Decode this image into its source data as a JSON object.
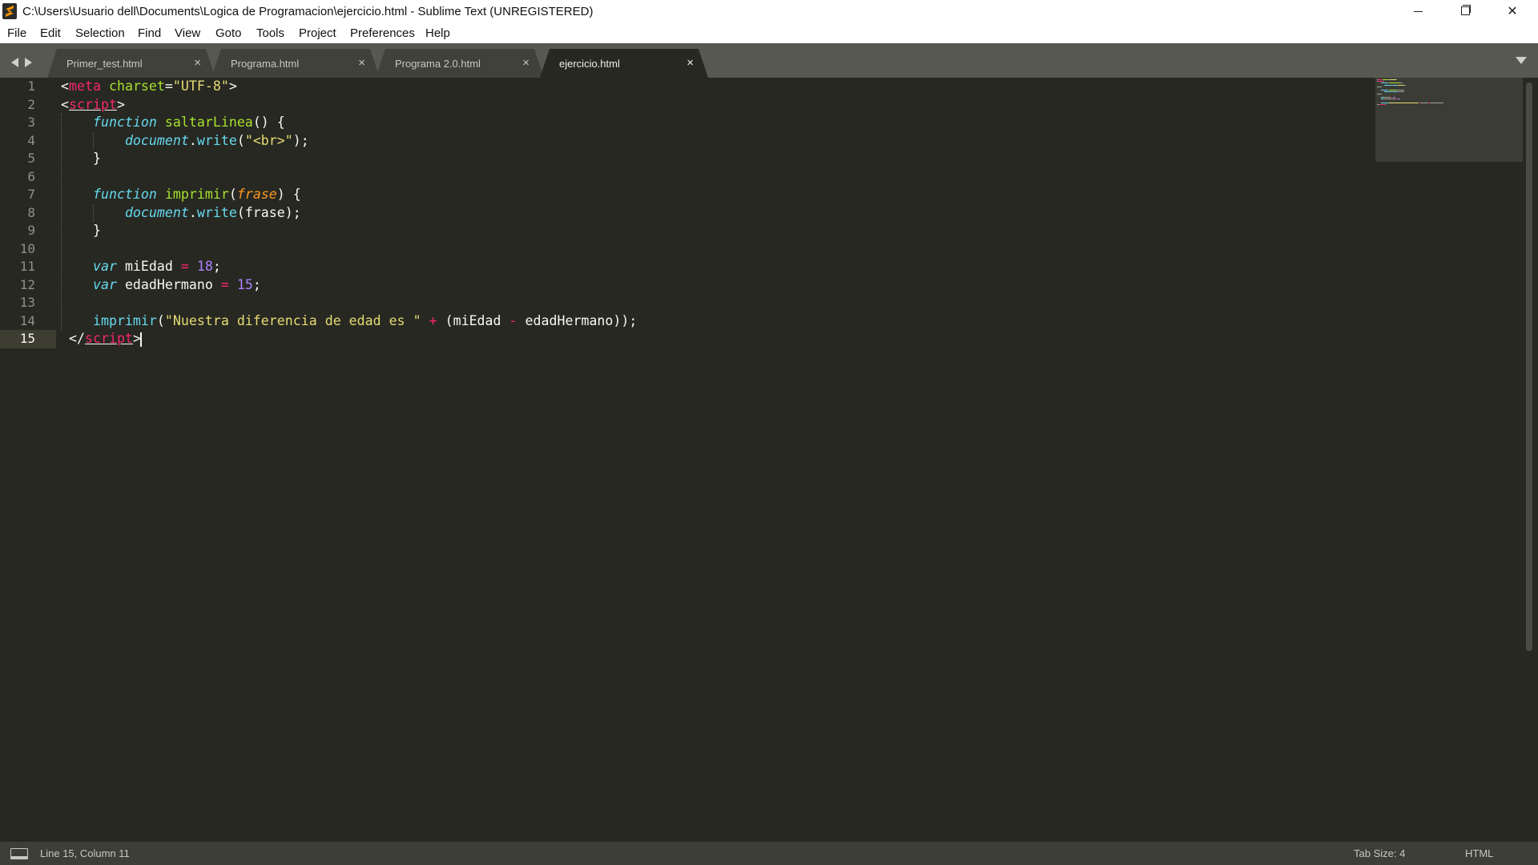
{
  "window": {
    "title": "C:\\Users\\Usuario dell\\Documents\\Logica de Programacion\\ejercicio.html - Sublime Text (UNREGISTERED)",
    "app_icon": "sublime-text-icon",
    "controls": [
      "minimize-icon",
      "maximize-icon",
      "close-icon"
    ]
  },
  "menu": {
    "items": [
      "File",
      "Edit",
      "Selection",
      "Find",
      "View",
      "Goto",
      "Tools",
      "Project",
      "Preferences",
      "Help"
    ]
  },
  "tabs": {
    "items": [
      {
        "label": "Primer_test.html",
        "close": "×",
        "active": false
      },
      {
        "label": "Programa.html",
        "close": "×",
        "active": false
      },
      {
        "label": "Programa 2.0.html",
        "close": "×",
        "active": false
      },
      {
        "label": "ejercicio.html",
        "close": "×",
        "active": true
      }
    ],
    "nav_icons": [
      "chevron-left-icon",
      "chevron-right-icon"
    ],
    "dropdown_icon": "chevron-down-icon"
  },
  "editor": {
    "current_line": 15,
    "line_numbers": [
      "1",
      "2",
      "3",
      "4",
      "5",
      "6",
      "7",
      "8",
      "9",
      "10",
      "11",
      "12",
      "13",
      "14",
      "15"
    ],
    "lines": [
      [
        {
          "t": "<",
          "c": ""
        },
        {
          "t": "meta",
          "c": "t-tag"
        },
        {
          "t": " ",
          "c": ""
        },
        {
          "t": "charset",
          "c": "t-attr"
        },
        {
          "t": "=",
          "c": ""
        },
        {
          "t": "\"UTF-8\"",
          "c": "t-str"
        },
        {
          "t": ">",
          "c": ""
        }
      ],
      [
        {
          "t": "<",
          "c": ""
        },
        {
          "t": "script",
          "c": "t-tag t-under"
        },
        {
          "t": ">",
          "c": ""
        }
      ],
      [
        {
          "t": "    ",
          "c": ""
        },
        {
          "t": "function",
          "c": "t-kw"
        },
        {
          "t": " ",
          "c": ""
        },
        {
          "t": "saltarLinea",
          "c": "t-fn"
        },
        {
          "t": "() {",
          "c": ""
        }
      ],
      [
        {
          "t": "        ",
          "c": ""
        },
        {
          "t": "document",
          "c": "t-obj"
        },
        {
          "t": ".",
          "c": ""
        },
        {
          "t": "write",
          "c": "t-call"
        },
        {
          "t": "(",
          "c": ""
        },
        {
          "t": "\"<br>\"",
          "c": "t-str"
        },
        {
          "t": ");",
          "c": ""
        }
      ],
      [
        {
          "t": "    }",
          "c": ""
        }
      ],
      [],
      [
        {
          "t": "    ",
          "c": ""
        },
        {
          "t": "function",
          "c": "t-kw"
        },
        {
          "t": " ",
          "c": ""
        },
        {
          "t": "imprimir",
          "c": "t-fn"
        },
        {
          "t": "(",
          "c": ""
        },
        {
          "t": "frase",
          "c": "t-param"
        },
        {
          "t": ") {",
          "c": ""
        }
      ],
      [
        {
          "t": "        ",
          "c": ""
        },
        {
          "t": "document",
          "c": "t-obj"
        },
        {
          "t": ".",
          "c": ""
        },
        {
          "t": "write",
          "c": "t-call"
        },
        {
          "t": "(frase);",
          "c": ""
        }
      ],
      [
        {
          "t": "    }",
          "c": ""
        }
      ],
      [],
      [
        {
          "t": "    ",
          "c": ""
        },
        {
          "t": "var",
          "c": "t-kw"
        },
        {
          "t": " miEdad ",
          "c": ""
        },
        {
          "t": "=",
          "c": "t-op"
        },
        {
          "t": " ",
          "c": ""
        },
        {
          "t": "18",
          "c": "t-num"
        },
        {
          "t": ";",
          "c": ""
        }
      ],
      [
        {
          "t": "    ",
          "c": ""
        },
        {
          "t": "var",
          "c": "t-kw"
        },
        {
          "t": " edadHermano ",
          "c": ""
        },
        {
          "t": "=",
          "c": "t-op"
        },
        {
          "t": " ",
          "c": ""
        },
        {
          "t": "15",
          "c": "t-num"
        },
        {
          "t": ";",
          "c": ""
        }
      ],
      [],
      [
        {
          "t": "    ",
          "c": ""
        },
        {
          "t": "imprimir",
          "c": "t-call"
        },
        {
          "t": "(",
          "c": ""
        },
        {
          "t": "\"Nuestra diferencia de edad es \"",
          "c": "t-str"
        },
        {
          "t": " ",
          "c": ""
        },
        {
          "t": "+",
          "c": "t-op"
        },
        {
          "t": " (miEdad ",
          "c": ""
        },
        {
          "t": "-",
          "c": "t-op"
        },
        {
          "t": " edadHermano));",
          "c": ""
        }
      ],
      [
        {
          "t": " </",
          "c": ""
        },
        {
          "t": "script",
          "c": "t-tag t-under"
        },
        {
          "t": ">",
          "c": ""
        }
      ]
    ]
  },
  "status": {
    "position": "Line 15, Column 11",
    "tab_size": "Tab Size: 4",
    "syntax": "HTML",
    "panel_icon": "panel-toggle-icon"
  }
}
